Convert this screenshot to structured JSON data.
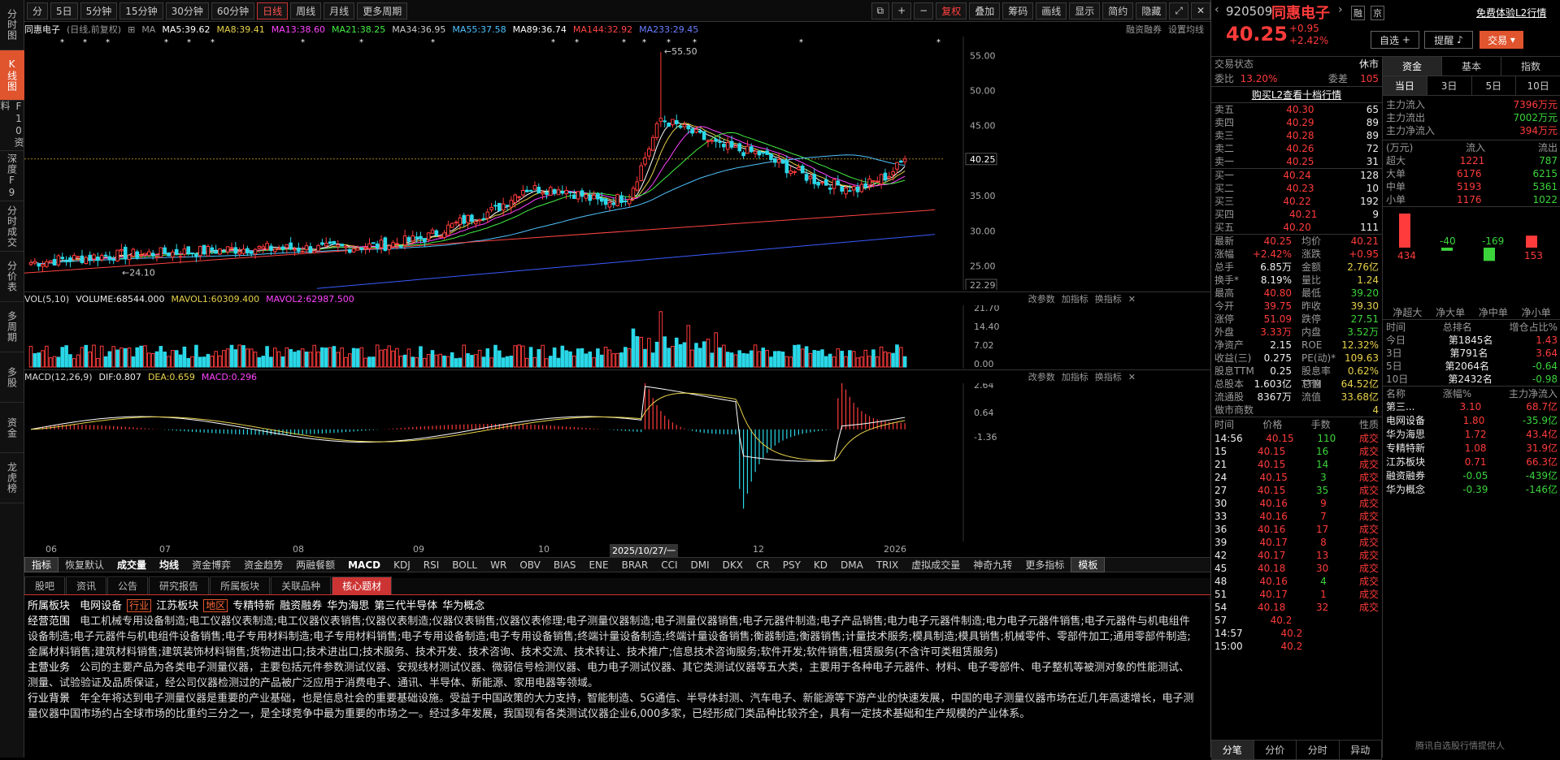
{
  "sidebar": [
    "分时图",
    "K线图",
    "F10资料",
    "深度F9",
    "分时成交",
    "分价表",
    "多周期",
    "多股",
    "资金",
    "龙虎榜"
  ],
  "sidebar_active": 1,
  "topbar": {
    "periods": [
      "分",
      "5日",
      "5分钟",
      "15分钟",
      "30分钟",
      "60分钟",
      "日线",
      "周线",
      "月线",
      "更多周期"
    ],
    "active_period": 6,
    "tools": [
      "复权",
      "叠加",
      "筹码",
      "画线",
      "显示",
      "简约",
      "隐藏"
    ]
  },
  "ma": {
    "name": "同惠电子",
    "mode": "(日线,前复权)",
    "ma_label": "MA",
    "items": [
      {
        "t": "MA5:39.62",
        "c": "#ffffff"
      },
      {
        "t": "MA8:39.41",
        "c": "#e8d24a"
      },
      {
        "t": "MA13:38.60",
        "c": "#ff44ff"
      },
      {
        "t": "MA21:38.25",
        "c": "#44ee44"
      },
      {
        "t": "MA34:36.95",
        "c": "#cccccc"
      },
      {
        "t": "MA55:37.58",
        "c": "#4fc3ff"
      },
      {
        "t": "MA89:36.74",
        "c": "#ffffff"
      },
      {
        "t": "MA144:32.92",
        "c": "#ff4444"
      },
      {
        "t": "MA233:29.45",
        "c": "#6a7dff"
      }
    ],
    "right1": "融资融券",
    "right2": "设置均线"
  },
  "price_axis": [
    "55.00",
    "50.00",
    "45.00",
    "40.25",
    "35.00",
    "30.00",
    "25.00",
    "22.29"
  ],
  "annot": {
    "high": "55.50",
    "low": "24.10"
  },
  "vol": {
    "label": "VOL(5,10)",
    "volume": "VOLUME:68544.000",
    "mavol1": "MAVOL1:60309.400",
    "mavol2": "MAVOL2:62987.500",
    "btns": [
      "改参数",
      "加指标",
      "换指标"
    ],
    "axis": [
      "21.70",
      "14.40",
      "7.02",
      "0.00"
    ]
  },
  "macd": {
    "label": "MACD(12,26,9)",
    "dif": "DIF:0.807",
    "dea": "DEA:0.659",
    "macd": "MACD:0.296",
    "axis": [
      "2.64",
      "0.64",
      "-1.36"
    ]
  },
  "xaxis": [
    "06",
    "07",
    "08",
    "09",
    "10",
    "2025/10/27/一",
    "12",
    "2026"
  ],
  "ind_tabs": [
    "指标",
    "恢复默认",
    "成交量",
    "均线",
    "资金博弈",
    "资金趋势",
    "两融餐额",
    "MACD",
    "KDJ",
    "RSI",
    "BOLL",
    "WR",
    "OBV",
    "BIAS",
    "ENE",
    "BRAR",
    "CCI",
    "DMI",
    "DKX",
    "CR",
    "PSY",
    "KD",
    "DMA",
    "TRIX",
    "虚拟成交量",
    "神奇九转",
    "更多指标",
    "模板"
  ],
  "f10_tabs": [
    "股吧",
    "资讯",
    "公告",
    "研究报告",
    "所属板块",
    "关联品种",
    "核心题材"
  ],
  "f10": {
    "sec_label": "所属板块",
    "sectors": [
      {
        "t": "电网设备",
        "box": ""
      },
      {
        "t": "行业",
        "box": "1"
      },
      {
        "t": "江苏板块",
        "box": ""
      },
      {
        "t": "地区",
        "box": "1"
      },
      {
        "t": "专精特新",
        "box": ""
      },
      {
        "t": "融资融券",
        "box": ""
      },
      {
        "t": "华为海思",
        "box": ""
      },
      {
        "t": "第三代半导体",
        "box": ""
      },
      {
        "t": "华为概念",
        "box": ""
      }
    ],
    "scope_label": "经营范围",
    "scope": "电工机械专用设备制造;电工仪器仪表制造;电工仪器仪表销售;仪器仪表制造;仪器仪表销售;仪器仪表修理;电子测量仪器制造;电子测量仪器销售;电子元器件制造;电子产品销售;电力电子元器件制造;电力电子元器件销售;电子元器件与机电组件设备制造;电子元器件与机电组件设备销售;电子专用材料制造;电子专用材料销售;电子专用设备制造;电子专用设备销售;终端计量设备制造;终端计量设备销售;衡器制造;衡器销售;计量技术服务;模具制造;模具销售;机械零件、零部件加工;通用零部件制造;金属材料销售;建筑材料销售;建筑装饰材料销售;货物进出口;技术进出口;技术服务、技术开发、技术咨询、技术交流、技术转让、技术推广;信息技术咨询服务;软件开发;软件销售;租赁服务(不含许可类租赁服务)",
    "biz_label": "主营业务",
    "biz": "公司的主要产品为各类电子测量仪器，主要包括元件参数测试仪器、安规线材测试仪器、微弱信号检测仪器、电力电子测试仪器、其它类测试仪器等五大类，主要用于各种电子元器件、材料、电子零部件、电子整机等被测对象的性能测试、测量、试验验证及品质保证，经公司仪器检测过的产品被广泛应用于消费电子、通讯、半导体、新能源、家用电器等领域。",
    "bg_label": "行业背景",
    "bg": "年全年将达到电子测量仪器是重要的产业基础，也是信息社会的重要基础设施。受益于中国政策的大力支持，智能制造、5G通信、半导体封测、汽车电子、新能源等下游产业的快速发展，中国的电子测量仪器市场在近几年高速增长，电子测量仪器中国市场约占全球市场的比重约三分之一，是全球竞争中最为重要的市场之一。经过多年发展，我国现有各类测试仪器企业6,000多家，已经形成门类品种比较齐全，具有一定技术基础和生产规模的产业体系。"
  },
  "right": {
    "code": "920509",
    "name": "同惠电子",
    "tags": [
      "融",
      "京"
    ],
    "promo": "免费体验L2行情",
    "price": "40.25",
    "chg": "+0.95",
    "pct": "+2.42%",
    "btn_add": "自选",
    "btn_remind": "提醒",
    "btn_trade": "交易",
    "trade_status_label": "交易状态",
    "trade_status": "休市",
    "weibi_label": "委比",
    "weibi": "13.20%",
    "weicha_label": "委差",
    "weicha": "105",
    "l2": "购买L2查看十档行情",
    "sells": [
      [
        "卖五",
        "40.30",
        "65"
      ],
      [
        "卖四",
        "40.29",
        "89"
      ],
      [
        "卖三",
        "40.28",
        "89"
      ],
      [
        "卖二",
        "40.26",
        "72"
      ],
      [
        "卖一",
        "40.25",
        "31"
      ]
    ],
    "buys": [
      [
        "买一",
        "40.24",
        "128"
      ],
      [
        "买二",
        "40.23",
        "10"
      ],
      [
        "买三",
        "40.22",
        "192"
      ],
      [
        "买四",
        "40.21",
        "9"
      ],
      [
        "买五",
        "40.20",
        "111"
      ]
    ],
    "quote": [
      [
        "最新",
        "40.25",
        "均价",
        "40.21"
      ],
      [
        "涨幅",
        "+2.42%",
        "涨跌",
        "+0.95"
      ],
      [
        "总手",
        "6.85万",
        "金额",
        "2.76亿"
      ],
      [
        "换手*",
        "8.19%",
        "量比",
        "1.24"
      ],
      [
        "最高",
        "40.80",
        "最低",
        "39.20"
      ],
      [
        "今开",
        "39.75",
        "昨收",
        "39.30"
      ],
      [
        "涨停",
        "51.09",
        "跌停",
        "27.51"
      ],
      [
        "外盘",
        "3.33万",
        "内盘",
        "3.52万"
      ],
      [
        "净资产",
        "2.15",
        "ROE",
        "12.32%"
      ],
      [
        "收益(三)",
        "0.275",
        "PE(动)*",
        "109.63"
      ],
      [
        "股息TTM",
        "0.25",
        "股息率TTM",
        "0.62%"
      ],
      [
        "总股本",
        "1.603亿",
        "总值",
        "64.52亿"
      ],
      [
        "流通股",
        "8367万",
        "流值",
        "33.68亿"
      ],
      [
        "做市商数",
        "",
        "",
        "4"
      ]
    ],
    "ticks_head": [
      "时间",
      "价格",
      "手数",
      "性质"
    ],
    "ticks": [
      [
        "14:56",
        "40.15",
        "110",
        "成交",
        "d"
      ],
      [
        "15",
        "40.15",
        "16",
        "成交",
        "d"
      ],
      [
        "21",
        "40.15",
        "14",
        "成交",
        "d"
      ],
      [
        "24",
        "40.15",
        "3",
        "成交",
        "d"
      ],
      [
        "27",
        "40.15",
        "35",
        "成交",
        "d"
      ],
      [
        "30",
        "40.16",
        "9",
        "成交",
        "u"
      ],
      [
        "33",
        "40.16",
        "7",
        "成交",
        "u"
      ],
      [
        "36",
        "40.16",
        "17",
        "成交",
        "u"
      ],
      [
        "39",
        "40.17",
        "8",
        "成交",
        "u"
      ],
      [
        "42",
        "40.17",
        "13",
        "成交",
        "u"
      ],
      [
        "45",
        "40.18",
        "30",
        "成交",
        "u"
      ],
      [
        "48",
        "40.16",
        "4",
        "成交",
        "d"
      ],
      [
        "51",
        "40.17",
        "1",
        "成交",
        "u"
      ],
      [
        "54",
        "40.18",
        "32",
        "成交",
        "u"
      ],
      [
        "57",
        "40.2",
        "",
        "",
        " "
      ],
      [
        "14:57",
        "40.2",
        "",
        "",
        " "
      ],
      [
        "15:00",
        "40.2",
        "",
        "",
        " "
      ]
    ],
    "bottom_tabs": [
      "分笔",
      "分价",
      "分时",
      "异动"
    ],
    "fund_tabs": [
      "资金",
      "基本",
      "指数"
    ],
    "period_tabs": [
      "当日",
      "3日",
      "5日",
      "10日"
    ],
    "main_flow": [
      [
        "主力流入",
        "7396万元"
      ],
      [
        "主力流出",
        "7002万元"
      ],
      [
        "主力净流入",
        "394万元"
      ]
    ],
    "flow_head": [
      "(万元)",
      "流入",
      "流出"
    ],
    "flow": [
      [
        "超大",
        "1221",
        "787"
      ],
      [
        "大单",
        "6176",
        "6215"
      ],
      [
        "中单",
        "5193",
        "5361"
      ],
      [
        "小单",
        "1176",
        "1022"
      ]
    ],
    "bar_vals": [
      "434",
      "-40",
      "-169",
      "153"
    ],
    "bar_labels": [
      "净超大",
      "净大单",
      "净中单",
      "净小单"
    ],
    "rank_head": [
      "时间",
      "总排名",
      "增仓占比%"
    ],
    "rank": [
      [
        "今日",
        "第1845名",
        "1.43"
      ],
      [
        "3日",
        "第791名",
        "3.64"
      ],
      [
        "5日",
        "第2064名",
        "-0.64"
      ],
      [
        "10日",
        "第2432名",
        "-0.98"
      ]
    ],
    "sector_head": [
      "名称",
      "涨幅%",
      "主力净流入"
    ],
    "sectors": [
      [
        "第三...",
        "3.10",
        "68.7亿"
      ],
      [
        "电网设备",
        "1.80",
        "-35.9亿"
      ],
      [
        "华为海思",
        "1.72",
        "43.4亿"
      ],
      [
        "专精特新",
        "1.08",
        "31.9亿"
      ],
      [
        "江苏板块",
        "0.71",
        "66.3亿"
      ],
      [
        "融资融券",
        "-0.05",
        "-439亿"
      ],
      [
        "华为概念",
        "-0.39",
        "-146亿"
      ]
    ],
    "footer": "腾讯自选股行情提供人"
  }
}
